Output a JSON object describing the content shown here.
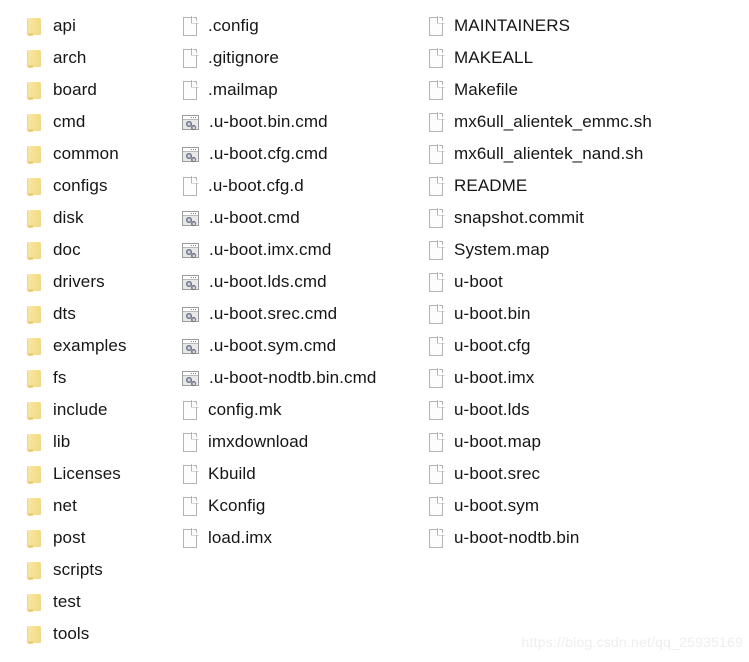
{
  "view": {
    "title": "u-boot source directory listing",
    "background_color": "#ffffff",
    "text_color": "#161616",
    "folder_color": "#f6e093"
  },
  "columns": [
    {
      "name": "column-1-folders",
      "items": [
        {
          "label": "api",
          "icon": "folder-icon",
          "type": "folder"
        },
        {
          "label": "arch",
          "icon": "folder-icon",
          "type": "folder"
        },
        {
          "label": "board",
          "icon": "folder-icon",
          "type": "folder"
        },
        {
          "label": "cmd",
          "icon": "folder-icon",
          "type": "folder"
        },
        {
          "label": "common",
          "icon": "folder-icon",
          "type": "folder"
        },
        {
          "label": "configs",
          "icon": "folder-icon",
          "type": "folder"
        },
        {
          "label": "disk",
          "icon": "folder-icon",
          "type": "folder"
        },
        {
          "label": "doc",
          "icon": "folder-icon",
          "type": "folder"
        },
        {
          "label": "drivers",
          "icon": "folder-icon",
          "type": "folder"
        },
        {
          "label": "dts",
          "icon": "folder-icon",
          "type": "folder"
        },
        {
          "label": "examples",
          "icon": "folder-icon",
          "type": "folder"
        },
        {
          "label": "fs",
          "icon": "folder-icon",
          "type": "folder"
        },
        {
          "label": "include",
          "icon": "folder-icon",
          "type": "folder"
        },
        {
          "label": "lib",
          "icon": "folder-icon",
          "type": "folder"
        },
        {
          "label": "Licenses",
          "icon": "folder-icon",
          "type": "folder"
        },
        {
          "label": "net",
          "icon": "folder-icon",
          "type": "folder"
        },
        {
          "label": "post",
          "icon": "folder-icon",
          "type": "folder"
        },
        {
          "label": "scripts",
          "icon": "folder-icon",
          "type": "folder"
        },
        {
          "label": "test",
          "icon": "folder-icon",
          "type": "folder"
        },
        {
          "label": "tools",
          "icon": "folder-icon",
          "type": "folder"
        }
      ]
    },
    {
      "name": "column-2-files",
      "items": [
        {
          "label": ".config",
          "icon": "document-icon",
          "type": "file"
        },
        {
          "label": ".gitignore",
          "icon": "document-icon",
          "type": "file"
        },
        {
          "label": ".mailmap",
          "icon": "document-icon",
          "type": "file"
        },
        {
          "label": ".u-boot.bin.cmd",
          "icon": "cmd-script-icon",
          "type": "cmd"
        },
        {
          "label": ".u-boot.cfg.cmd",
          "icon": "cmd-script-icon",
          "type": "cmd"
        },
        {
          "label": ".u-boot.cfg.d",
          "icon": "document-icon",
          "type": "file"
        },
        {
          "label": ".u-boot.cmd",
          "icon": "cmd-script-icon",
          "type": "cmd"
        },
        {
          "label": ".u-boot.imx.cmd",
          "icon": "cmd-script-icon",
          "type": "cmd"
        },
        {
          "label": ".u-boot.lds.cmd",
          "icon": "cmd-script-icon",
          "type": "cmd"
        },
        {
          "label": ".u-boot.srec.cmd",
          "icon": "cmd-script-icon",
          "type": "cmd"
        },
        {
          "label": ".u-boot.sym.cmd",
          "icon": "cmd-script-icon",
          "type": "cmd"
        },
        {
          "label": ".u-boot-nodtb.bin.cmd",
          "icon": "cmd-script-icon",
          "type": "cmd"
        },
        {
          "label": "config.mk",
          "icon": "document-icon",
          "type": "file"
        },
        {
          "label": "imxdownload",
          "icon": "document-icon",
          "type": "file"
        },
        {
          "label": "Kbuild",
          "icon": "document-icon",
          "type": "file"
        },
        {
          "label": "Kconfig",
          "icon": "document-icon",
          "type": "file"
        },
        {
          "label": "load.imx",
          "icon": "document-icon",
          "type": "file"
        }
      ]
    },
    {
      "name": "column-3-files",
      "items": [
        {
          "label": "MAINTAINERS",
          "icon": "document-icon",
          "type": "file"
        },
        {
          "label": "MAKEALL",
          "icon": "document-icon",
          "type": "file"
        },
        {
          "label": "Makefile",
          "icon": "document-icon",
          "type": "file"
        },
        {
          "label": "mx6ull_alientek_emmc.sh",
          "icon": "document-icon",
          "type": "file"
        },
        {
          "label": "mx6ull_alientek_nand.sh",
          "icon": "document-icon",
          "type": "file"
        },
        {
          "label": "README",
          "icon": "document-icon",
          "type": "file"
        },
        {
          "label": "snapshot.commit",
          "icon": "document-icon",
          "type": "file"
        },
        {
          "label": "System.map",
          "icon": "document-icon",
          "type": "file"
        },
        {
          "label": "u-boot",
          "icon": "document-icon",
          "type": "file"
        },
        {
          "label": "u-boot.bin",
          "icon": "document-icon",
          "type": "file"
        },
        {
          "label": "u-boot.cfg",
          "icon": "document-icon",
          "type": "file"
        },
        {
          "label": "u-boot.imx",
          "icon": "document-icon",
          "type": "file"
        },
        {
          "label": "u-boot.lds",
          "icon": "document-icon",
          "type": "file"
        },
        {
          "label": "u-boot.map",
          "icon": "document-icon",
          "type": "file"
        },
        {
          "label": "u-boot.srec",
          "icon": "document-icon",
          "type": "file"
        },
        {
          "label": "u-boot.sym",
          "icon": "document-icon",
          "type": "file"
        },
        {
          "label": "u-boot-nodtb.bin",
          "icon": "document-icon",
          "type": "file"
        }
      ]
    }
  ],
  "watermark": {
    "text": "https://blog.csdn.net/qq_25935169"
  }
}
